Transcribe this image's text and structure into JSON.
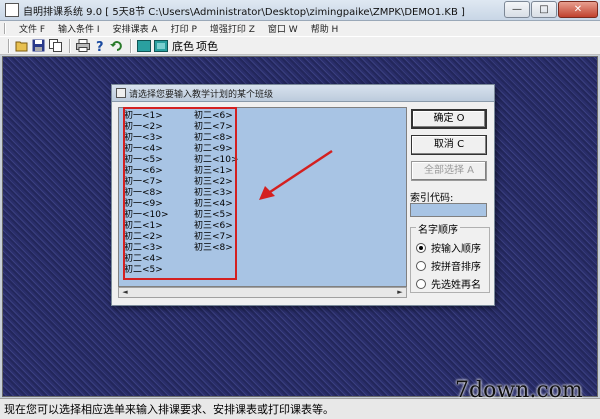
{
  "window": {
    "title": "自明排课系统 9.0 [ 5天8节 C:\\Users\\Administrator\\Desktop\\zimingpaike\\ZMPK\\DEMO1.KB ]",
    "controls": {
      "minimize": "—",
      "maximize": "□",
      "close": "✕"
    }
  },
  "menu": [
    "文件 F",
    "输入条件 I",
    "安排课表 A",
    "打印 P",
    "增强打印 Z",
    "窗口 W",
    "帮助 H"
  ],
  "toolbar": {
    "icons": [
      "folder-open-icon",
      "save-icon",
      "copy-icon",
      "print-icon",
      "help-icon",
      "undo-icon",
      "grid-icon",
      "grid-alt-icon"
    ],
    "labels": [
      "底色",
      "项色"
    ]
  },
  "dialog": {
    "title": "请选择您要输入教学计划的某个班级",
    "list_col1": [
      "初一<1>",
      "初一<2>",
      "初一<3>",
      "初一<4>",
      "初一<5>",
      "初一<6>",
      "初一<7>",
      "初一<8>",
      "初一<9>",
      "初一<10>",
      "初二<1>",
      "初二<2>",
      "初二<3>",
      "初二<4>",
      "初二<5>"
    ],
    "list_col2": [
      "初二<6>",
      "初二<7>",
      "初二<8>",
      "初二<9>",
      "初二<10>",
      "初三<1>",
      "初三<2>",
      "初三<3>",
      "初三<4>",
      "初三<5>",
      "初三<6>",
      "初三<7>",
      "初三<8>"
    ],
    "ok_label": "确定 O",
    "cancel_label": "取消 C",
    "select_all_label": "全部选择 A",
    "index_code_label": "索引代码:",
    "index_code_value": "",
    "name_order": {
      "legend": "名字顺序",
      "options": [
        "按输入顺序",
        "按拼音排序",
        "先选姓再名"
      ],
      "selected": "按输入顺序"
    },
    "annotation_color": "#d42020"
  },
  "status": {
    "text": "现在您可以选择相应选单来输入排课要求、安排课表或打印课表等。"
  },
  "watermark": {
    "text": "7down.com"
  }
}
